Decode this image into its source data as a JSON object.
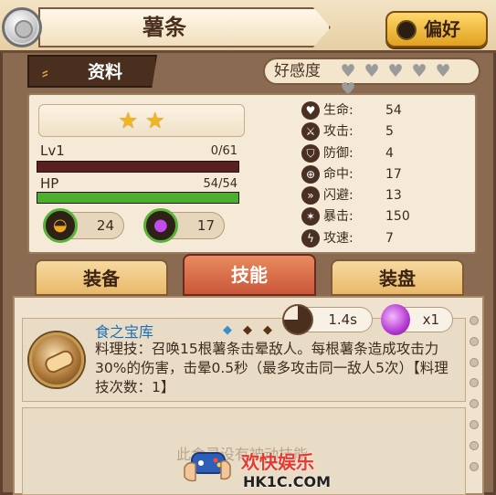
{
  "header": {
    "title": "薯条",
    "favorite_label": "偏好"
  },
  "info_tab": {
    "label": "资料"
  },
  "affinity": {
    "label": "好感度",
    "hearts_total": 6,
    "hearts_filled": 0
  },
  "character": {
    "stars": 2,
    "level_label": "Lv1",
    "exp_text": "0/61",
    "exp_fraction": 0.0,
    "hp_label": "HP",
    "hp_text": "54/54",
    "hp_fraction": 1.0,
    "resource1_value": "24",
    "resource2_value": "17"
  },
  "stats": [
    {
      "name": "生命:",
      "value": "54",
      "icon": "heart-icon"
    },
    {
      "name": "攻击:",
      "value": "5",
      "icon": "attack-icon"
    },
    {
      "name": "防御:",
      "value": "4",
      "icon": "shield-icon"
    },
    {
      "name": "命中:",
      "value": "17",
      "icon": "crosshair-icon"
    },
    {
      "name": "闪避:",
      "value": "13",
      "icon": "dodge-icon"
    },
    {
      "name": "暴击:",
      "value": "150",
      "icon": "crit-icon"
    },
    {
      "name": "攻速:",
      "value": "7",
      "icon": "speed-icon"
    }
  ],
  "tabs": [
    {
      "label": "装备",
      "active": false
    },
    {
      "label": "技能",
      "active": true
    },
    {
      "label": "装盘",
      "active": false
    }
  ],
  "skill": {
    "name": "食之宝库",
    "cooldown": "1.4s",
    "uses": "x1",
    "description": "料理技：召唤15根薯条击晕敌人。每根薯条造成攻击力30%的伤害，击晕0.5秒（最多攻击同一敌人5次）【料理技次数：1】"
  },
  "empty_skill_text": "此食灵没有被动技能",
  "watermark": {
    "title": "欢快娱乐",
    "url": "HK1C.COM"
  },
  "colors": {
    "hp_green": "#4caf2e",
    "exp_track": "#5a1f1f",
    "active_tab": "#c9573a",
    "skill_name_blue": "#1f6fb5"
  }
}
